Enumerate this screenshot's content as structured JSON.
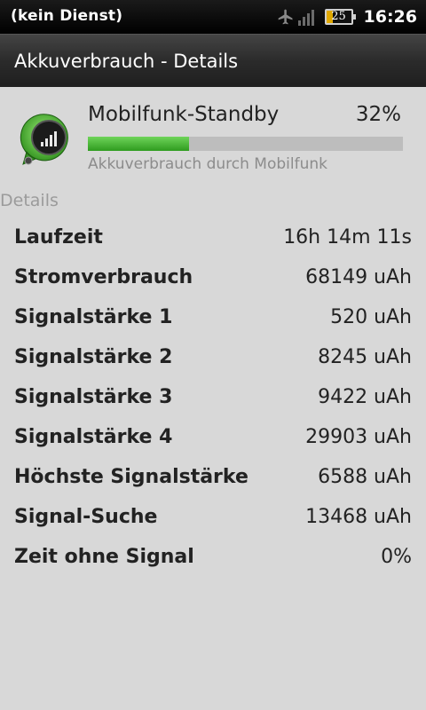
{
  "status_bar": {
    "carrier": "(kein Dienst)",
    "battery_level": "25",
    "time": "16:26"
  },
  "title_bar": {
    "title": "Akkuverbrauch - Details"
  },
  "usage": {
    "name": "Mobilfunk-Standby",
    "percent": "32%",
    "percent_value": 32,
    "bar_color": "#3aa82a",
    "subtitle": "Akkuverbrauch durch Mobilfunk",
    "icon": "cell-signal-icon"
  },
  "details": {
    "header": "Details",
    "rows": [
      {
        "label": "Laufzeit",
        "value": "16h 14m 11s"
      },
      {
        "label": "Stromverbrauch",
        "value": "68149 uAh"
      },
      {
        "label": "Signalstärke 1",
        "value": "520 uAh"
      },
      {
        "label": "Signalstärke 2",
        "value": "8245 uAh"
      },
      {
        "label": "Signalstärke 3",
        "value": "9422 uAh"
      },
      {
        "label": "Signalstärke 4",
        "value": "29903 uAh"
      },
      {
        "label": "Höchste Signalstärke",
        "value": "6588 uAh"
      },
      {
        "label": "Signal-Suche",
        "value": "13468 uAh"
      },
      {
        "label": "Zeit ohne Signal",
        "value": "0%"
      }
    ]
  }
}
